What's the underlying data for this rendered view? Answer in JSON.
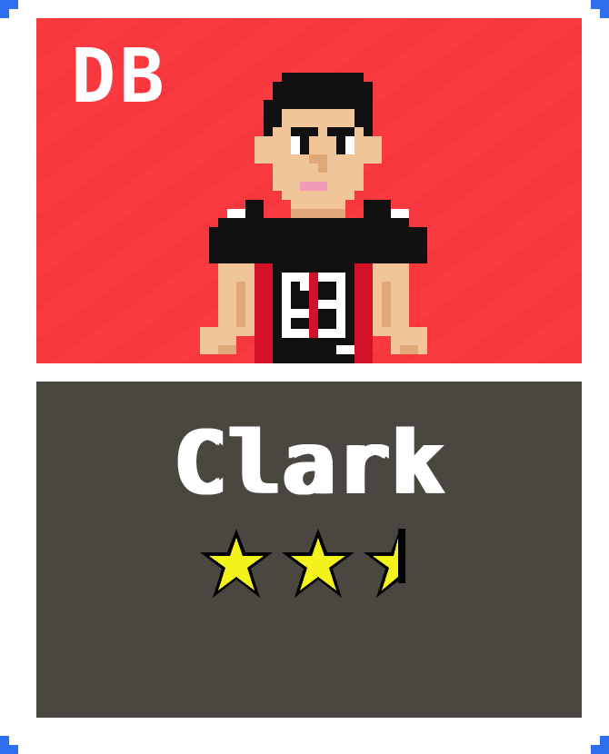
{
  "card": {
    "position": "DB",
    "player_name": "Clark",
    "jersey_number": "26",
    "rating_stars": 2.5,
    "rating_max": 3,
    "colors": {
      "border_accent": "#2e6ff0",
      "frame": "#ffffff",
      "portrait_bg": "#f6373d",
      "info_bg": "#4a4740",
      "star_fill": "#f4f21b",
      "star_outline": "#000000",
      "jersey": "#111111",
      "jersey_trim": "#d3122a",
      "skin": "#f1c59a"
    },
    "icons": [
      "player-sprite",
      "star-icon"
    ]
  }
}
